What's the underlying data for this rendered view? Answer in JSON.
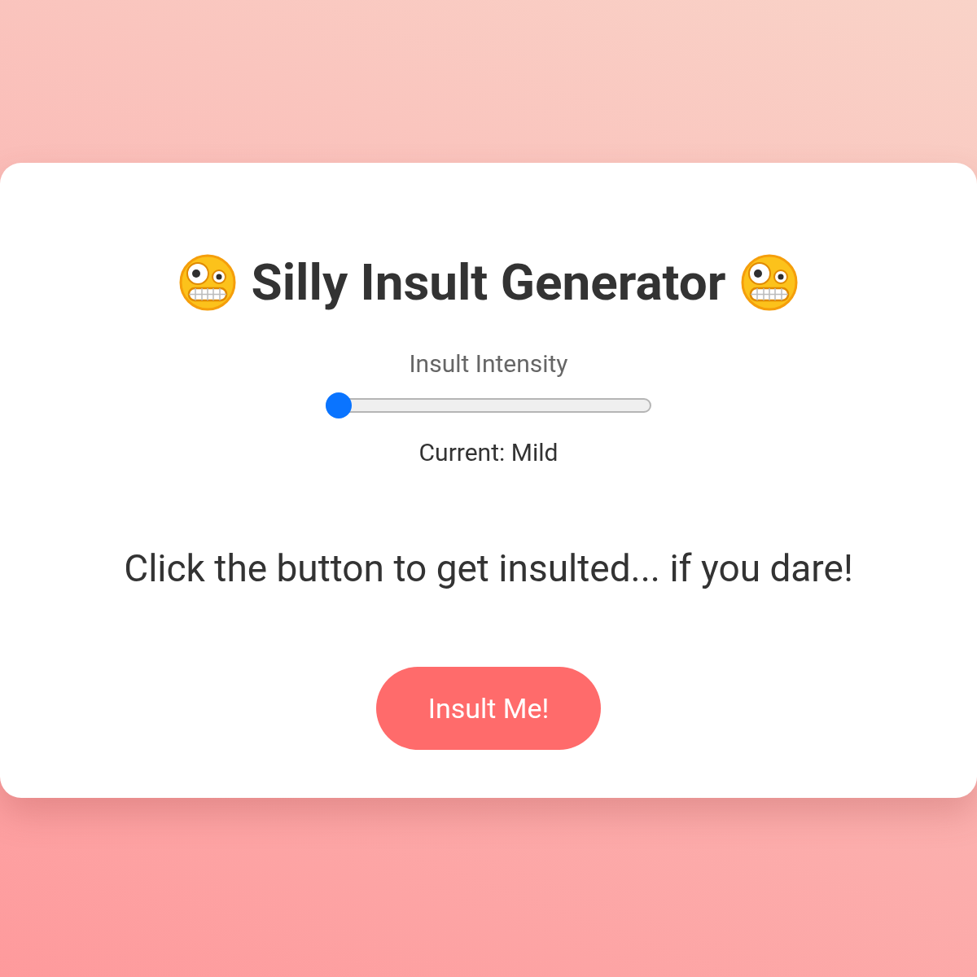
{
  "title": "Silly Insult Generator",
  "intensity": {
    "label": "Insult Intensity",
    "level": 0,
    "reading": "Current: Mild"
  },
  "message": "Click the button to get insulted... if you dare!",
  "button": "Insult Me!"
}
